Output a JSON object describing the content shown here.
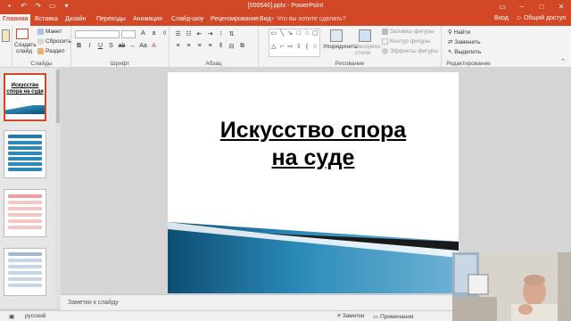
{
  "window": {
    "title": "[000546].pptx - PowerPoint"
  },
  "tabs": [
    {
      "label": "Главная",
      "active": true
    },
    {
      "label": "Вставка"
    },
    {
      "label": "Дизайн"
    },
    {
      "label": "Переходы"
    },
    {
      "label": "Анимация"
    },
    {
      "label": "Слайд-шоу"
    },
    {
      "label": "Рецензирование"
    },
    {
      "label": "Вид"
    }
  ],
  "tell_me": "Что вы хотите сделать?",
  "account": {
    "signin": "Вход",
    "share": "Общий доступ"
  },
  "ribbon": {
    "slides": {
      "new_slide": "Создать слайд",
      "layout": "Макет",
      "reset": "Сбросить",
      "section": "Раздел",
      "label": "Слайды"
    },
    "font": {
      "label": "Шрифт"
    },
    "paragraph": {
      "label": "Абзац"
    },
    "drawing": {
      "arrange": "Упорядочить",
      "quick_styles": "Экспресс-стили",
      "shape_fill": "Заливка фигуры",
      "shape_outline": "Контур фигуры",
      "shape_effects": "Эффекты фигуры",
      "label": "Рисование"
    },
    "editing": {
      "find": "Найти",
      "replace": "Заменить",
      "select": "Выделить",
      "label": "Редактирование"
    }
  },
  "thumbnails": [
    {
      "title": "Искусство спора на суде"
    }
  ],
  "slide": {
    "title_line1": "Искусство спора",
    "title_line2": "на суде"
  },
  "notes_placeholder": "Заметки к слайду",
  "status": {
    "language": "русский",
    "notes": "Заметки",
    "comments": "Примечания"
  },
  "colors": {
    "accent": "#d24726",
    "wave_dark": "#0d4d72",
    "wave_light": "#2b8ab8"
  }
}
